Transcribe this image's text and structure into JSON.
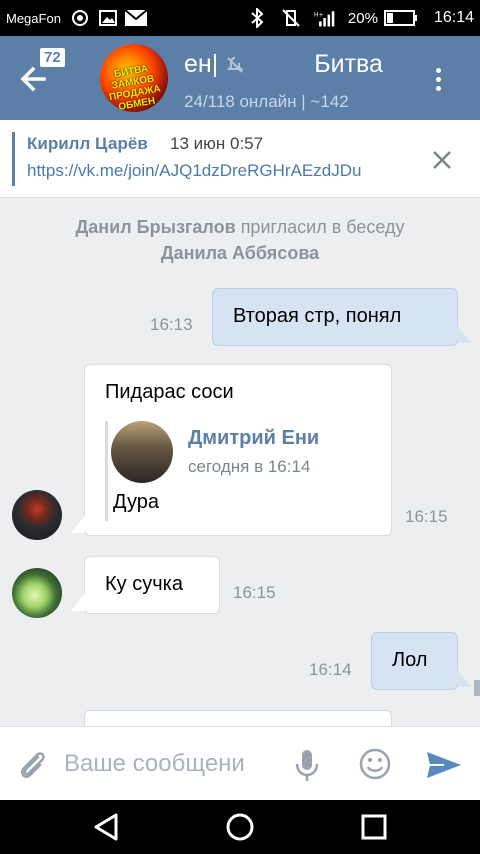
{
  "status_bar": {
    "carrier": "MegaFon",
    "battery": "20%",
    "time": "16:14",
    "icons": [
      "hotspot-icon",
      "image-icon",
      "mail-icon",
      "bluetooth-icon",
      "vibrate-off-icon",
      "signal-icon",
      "battery-icon"
    ]
  },
  "header": {
    "back_badge": "72",
    "title_left": "ен|",
    "title_right": "Битва",
    "subtitle": "24/118 онлайн | ~142",
    "avatar_text": "БИТВА ЗАМКОВ ПРОДАЖА ОБМЕН"
  },
  "pinned": {
    "author": "Кирилл Царёв",
    "date": "13 июн 0:57",
    "link": "https://vk.me/join/AJQ1dzDreRGHrAEzdJDu"
  },
  "service_message": {
    "actor": "Данил Брызгалов",
    "action": "пригласил в беседу",
    "target": "Данила Аббясова"
  },
  "messages": [
    {
      "text": "Вторая стр, понял",
      "time": "16:13",
      "direction": "out"
    },
    {
      "text": "Пидарас соси",
      "time": "16:15",
      "direction": "in",
      "forwarded": {
        "name": "Дмитрий Ени",
        "date": "сегодня в 16:14",
        "text": "Дура"
      }
    },
    {
      "text": "Ку сучка",
      "time": "16:15",
      "direction": "in"
    },
    {
      "text": "Лол",
      "time": "16:14",
      "direction": "out"
    }
  ],
  "composer": {
    "placeholder": "Ваше сообщени"
  },
  "colors": {
    "header": "#5b7fa6",
    "outgoing_bubble": "#d6e3f3",
    "background": "#edeef0"
  }
}
